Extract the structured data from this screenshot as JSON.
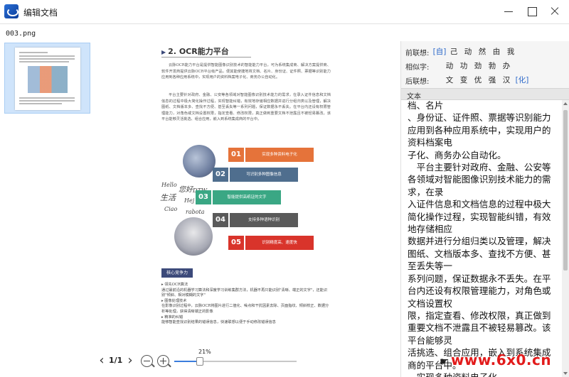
{
  "window": {
    "title": "编辑文档"
  },
  "file": {
    "name": "003.png"
  },
  "document": {
    "section_title": "2. OCR能力平台",
    "paragraph1": "云脉OCR能力平台是提供智能图像识别技术的智能能力平台，可为系统集成商、解决方案提供商、软件开发商提供云脉OCR平台级产品，便其能使捷地将文档、名片、身份证、证件照、票据等识别能力应用到各种应用系统中，实现用户的资料档案电子化、商务办公自动化。",
    "paragraph2": "平台主要针对政府、金融、公安等各领域对智能图像识别技术能力的需求，在录入证件信息和文档信息的过程中极大简化操作过程，实现智能纠错，有效地存储相应数据并进行分组归类以及管理，解决图纸、文档版本多、查找不方便、甚至丢失等一系列问题，保证数据永不丢失。在平台内还设有权限管理能力，对角色或文档设置权限，指定查看、修改权限，真正做到重要文档不泄露且不被轻易篡改。该平台能够灵活挑选、组合应用，嵌入到系统集成商的平台中。",
    "handwriting": [
      "Hello",
      "您好",
      "DTW",
      "生活",
      "Hej",
      "Ciao",
      "rabota"
    ],
    "steps": [
      {
        "num": "01",
        "label": "实现多种资料电子化"
      },
      {
        "num": "02",
        "label": "可识别多种图像信息"
      },
      {
        "num": "03",
        "label": "智能提供高纸证的文字"
      },
      {
        "num": "04",
        "label": "支持多种语种识别"
      },
      {
        "num": "05",
        "label": "识别精度高、速度快"
      }
    ],
    "core_tag": "核心竞争力",
    "bullets": "▸ 领先OCR算法\n通过最前沿的机器学习算法和深度学习训练集群方法，机器不再只能识别\"清晰、端正的文字\"，还能识别\"倾斜、相对模糊的文字\"\n▸ 图像处理技术\n在影像识别过程中，云脉OCR将图片进行二值化、噪点和干扰因素去除、页面指纹、倾斜校正、数据分析等处理，获得清晰端正的影像\n▸ 精准的纠错\n能够智能查找识别结果的错误信息，快速联想以便于手动修改错误信息"
  },
  "viewer": {
    "page_indicator": "1/1",
    "zoom_percent": "21%",
    "zoom_fraction": 0.21,
    "prev_icon": "chevron-left-icon",
    "next_icon": "chevron-right-icon"
  },
  "assoc": {
    "before_label": "前联想:",
    "before_chars": [
      "[自]",
      "己",
      "动",
      "然",
      "由",
      "我"
    ],
    "similar_label": "相似字:",
    "similar_chars": [
      "动",
      "功",
      "劲",
      "勃",
      "办"
    ],
    "after_label": "后联想:",
    "after_chars": [
      "文",
      "变",
      "优",
      "强",
      "汉",
      "[化]"
    ]
  },
  "text_panel": {
    "header": "文本",
    "content": "档、名片\n、身份证、证件照、票据等识别能力应用到各种应用系统中，实现用户的资料档案电\n子化、商务办公自动化。\n　平台主要针对政府、金融、公安等各领域对智能图像识别技术能力的需求，在录\n入证件信息和文档信息的过程中极大简化操作过程，实现智能纠错，有效地存储相应\n数据并进行分组归类以及管理，解决图纸、文档版本多、查找不方便、甚至丢失等一\n系列问题，保证数据永不丢失。在平台内还设有权限管理能力，对角色或文档设置权\n限，指定查看、修改权限，真正做到重要文档不泄露且不被轻易篡改。该平台能够灵\n活挑选、组合应用，嵌入到系统集成商的平台中。\n　实现多种资料电子化"
  },
  "watermark": {
    "text": "www.6x0.cn"
  },
  "colors": {
    "accent": "#3b7ddd",
    "selection": "#cfe4fb",
    "bracket_char": "#2a67c9",
    "watermark": "#e21b1b"
  }
}
